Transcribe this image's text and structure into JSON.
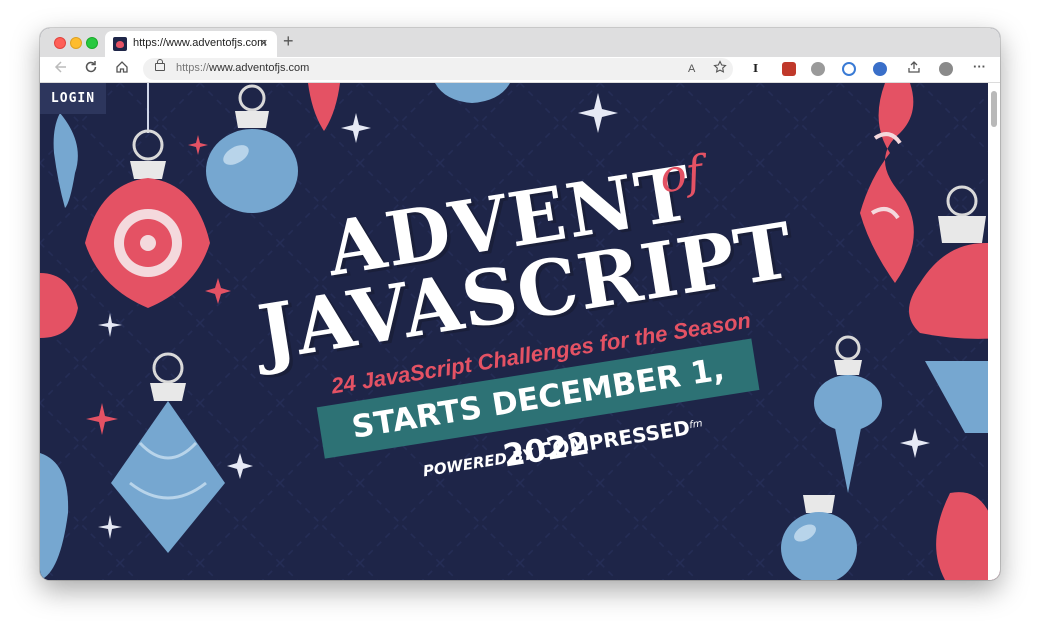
{
  "browser": {
    "tab_title": "https://www.adventofjs.com",
    "tab_close": "×",
    "new_tab": "+",
    "url_prefix": "https://",
    "url_host": "www.adventofjs.com",
    "profile_icon": "avatar-icon",
    "more": "···",
    "reader_mode": "A",
    "ext_letter": "I"
  },
  "page": {
    "login": "LOGIN",
    "title_line1": "ADVENT",
    "title_of": "of",
    "title_line2": "JAVASCRIPT",
    "subtitle": "24 JavaScript Challenges for the Season",
    "banner": "STARTS DECEMBER 1, 2022",
    "powered_by": "POWERED BY",
    "sponsor": "COMPRESSED",
    "sponsor_suffix": "fm"
  },
  "colors": {
    "background": "#1e2548",
    "ornament_red": "#e45264",
    "ornament_blue": "#76a7d0",
    "banner_teal": "#2d7275",
    "title_white": "#ffffff"
  }
}
